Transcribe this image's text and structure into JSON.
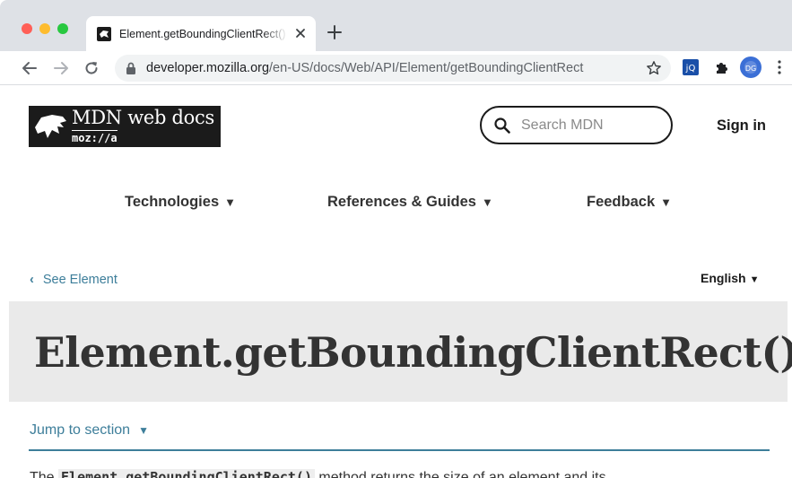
{
  "browser": {
    "tab": {
      "title": "Element.getBoundingClientRect() - Web APIs | MDN"
    },
    "address_bar": {
      "host": "developer.mozilla.org",
      "path": "/en-US/docs/Web/API/Element/getBoundingClientRect"
    },
    "extensions": [
      {
        "icon": "jquery-extension-icon",
        "label": "jQ"
      },
      {
        "icon": "puzzle-extensions-icon"
      },
      {
        "icon": "profile-avatar-icon",
        "label": "DG"
      }
    ],
    "colors": {
      "tabstrip": "#dee1e6",
      "omnibox": "#f1f3f4"
    }
  },
  "header": {
    "logo": {
      "name": "MDN web docs",
      "sub": "moz://a"
    },
    "search_placeholder": "Search MDN",
    "sign_in": "Sign in"
  },
  "main_nav": [
    {
      "label": "Technologies"
    },
    {
      "label": "References & Guides"
    },
    {
      "label": "Feedback"
    }
  ],
  "breadcrumb": {
    "back_label": "See Element"
  },
  "language": {
    "label": "English"
  },
  "article": {
    "title": "Element.getBoundingClientRect()",
    "jump_label": "Jump to section",
    "intro": {
      "before": "The ",
      "code": "Element.getBoundingClientRect()",
      "after": " method returns the size of an element and its"
    }
  },
  "colors": {
    "link": "#3d7e9a",
    "title_band": "#eaeaea",
    "text": "#1b1b1b"
  }
}
